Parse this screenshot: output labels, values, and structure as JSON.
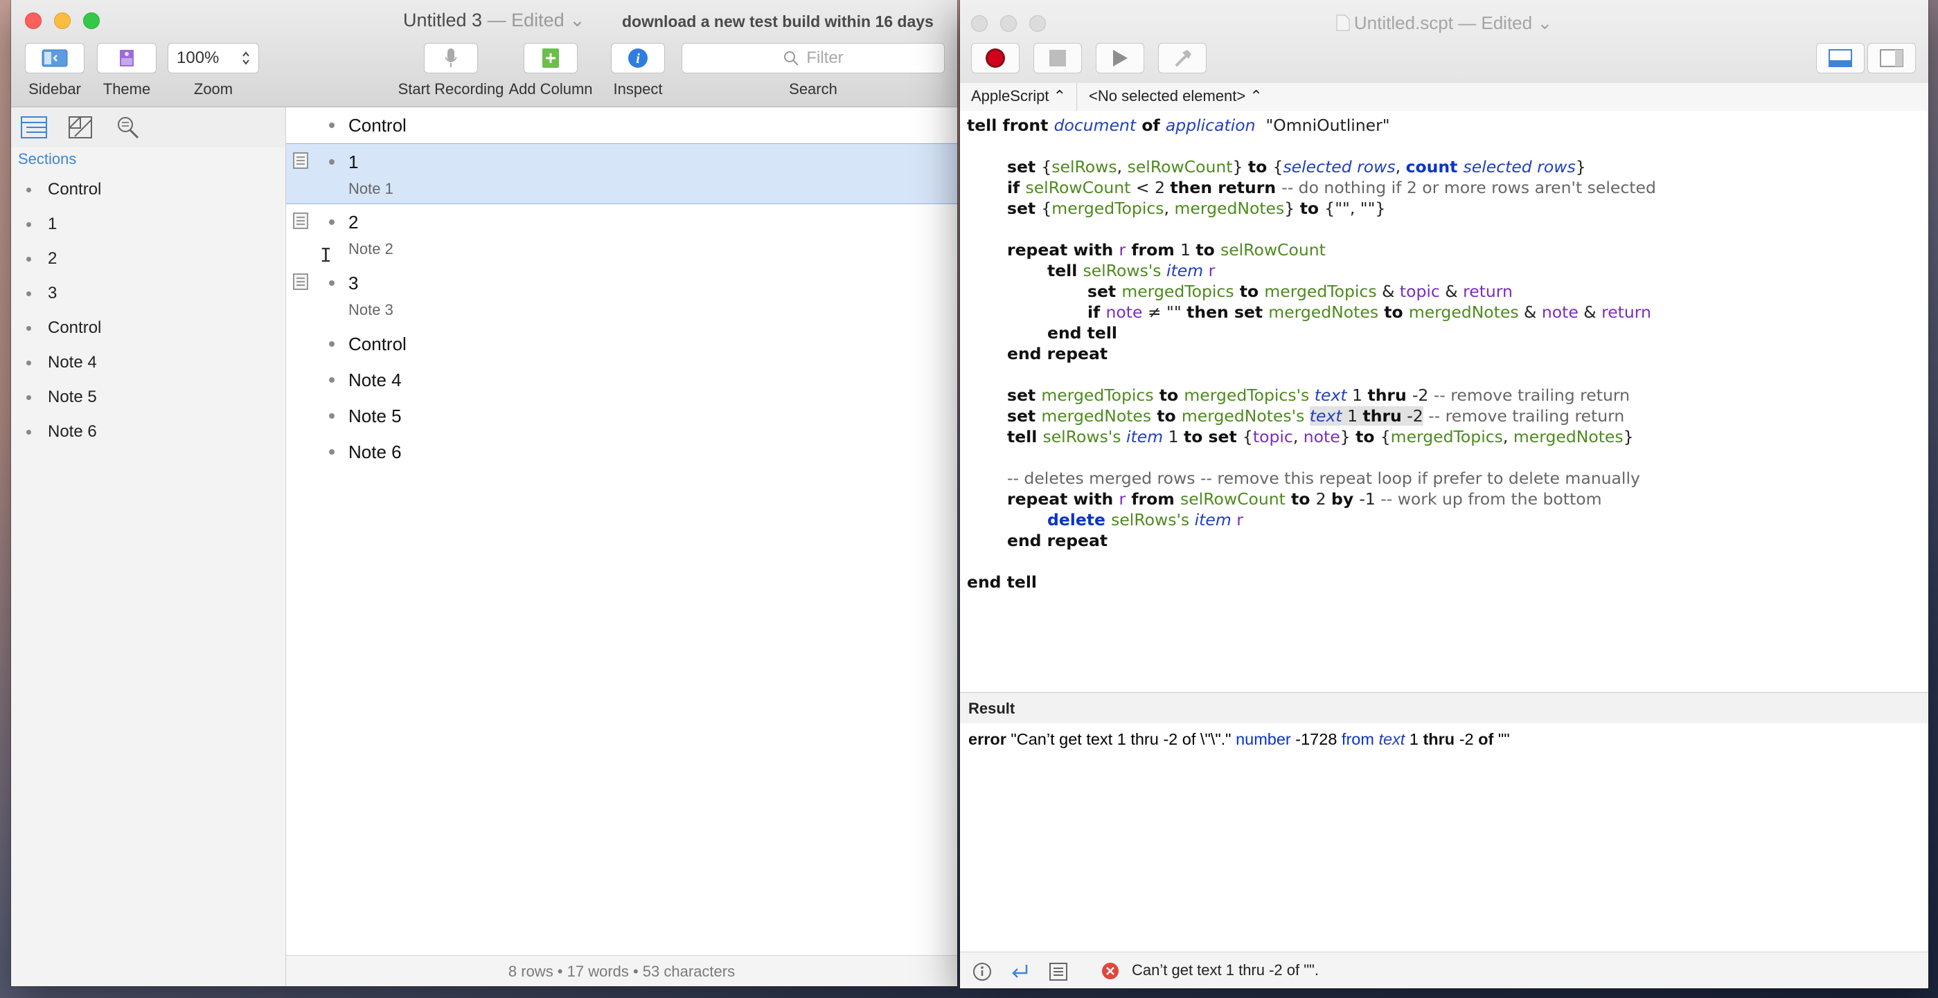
{
  "outliner": {
    "title": "Untitled 3",
    "edited": " — Edited ⌄",
    "notice": "download a new test build within 16 days",
    "toolbar": {
      "sidebar_label": "Sidebar",
      "theme_label": "Theme",
      "zoom_label": "Zoom",
      "zoom_value": "100%",
      "record_label": "Start Recording",
      "add_column_label": "Add Column",
      "inspect_label": "Inspect",
      "search_label": "Search",
      "filter_placeholder": "Filter"
    },
    "sidebar": {
      "section_header": "Sections",
      "items": [
        "Control",
        "1",
        "2",
        "3",
        "Control",
        "Note 4",
        "Note 5",
        "Note 6"
      ]
    },
    "rows": [
      {
        "topic": "Control",
        "note": ""
      },
      {
        "topic": "1",
        "note": "Note 1"
      },
      {
        "topic": "2",
        "note": "Note 2"
      },
      {
        "topic": "3",
        "note": "Note 3"
      },
      {
        "topic": "Control",
        "note": ""
      },
      {
        "topic": "Note 4",
        "note": ""
      },
      {
        "topic": "Note 5",
        "note": ""
      },
      {
        "topic": "Note 6",
        "note": ""
      }
    ],
    "status": "8 rows • 17 words • 53 characters"
  },
  "script_editor": {
    "title": "Untitled.scpt",
    "edited": " — Edited ⌄",
    "language": "AppleScript ⌃",
    "element": "<No selected element> ⌃",
    "result_header": "Result",
    "result": {
      "p1": "error",
      "p2": " \"Can’t get text 1 thru -2 of \\\"\\\".\" ",
      "p3": "number",
      "p4": " -1728 ",
      "p5": "from",
      "p6": " ",
      "p7": "text",
      "p8": " 1 ",
      "p9": "thru",
      "p10": " -2 ",
      "p11": "of",
      "p12": " \"\""
    },
    "status_message": "Can’t get text 1 thru -2 of \"\".",
    "code": [
      {
        "indent": 0,
        "segs": [
          [
            "k",
            "tell front "
          ],
          [
            "app",
            "document"
          ],
          [
            "k",
            " of "
          ],
          [
            "app",
            "application"
          ],
          [
            "",
            "  \"OmniOutliner\""
          ]
        ]
      },
      {
        "indent": 0,
        "segs": []
      },
      {
        "indent": 1,
        "segs": [
          [
            "k",
            "set "
          ],
          [
            "",
            "{"
          ],
          [
            "g",
            "selRows"
          ],
          [
            "",
            ", "
          ],
          [
            "g",
            "selRowCount"
          ],
          [
            "",
            "} "
          ],
          [
            "k",
            "to "
          ],
          [
            "",
            "{"
          ],
          [
            "app",
            "selected rows"
          ],
          [
            "",
            ", "
          ],
          [
            "kb",
            "count "
          ],
          [
            "app",
            "selected rows"
          ],
          [
            "",
            "}"
          ]
        ]
      },
      {
        "indent": 1,
        "segs": [
          [
            "k",
            "if "
          ],
          [
            "g",
            "selRowCount"
          ],
          [
            "",
            " < 2 "
          ],
          [
            "k",
            "then return "
          ],
          [
            "cm",
            "-- do nothing if 2 or more rows aren't selected"
          ]
        ]
      },
      {
        "indent": 1,
        "segs": [
          [
            "k",
            "set "
          ],
          [
            "",
            "{"
          ],
          [
            "g",
            "mergedTopics"
          ],
          [
            "",
            ", "
          ],
          [
            "g",
            "mergedNotes"
          ],
          [
            "",
            "} "
          ],
          [
            "k",
            "to "
          ],
          [
            "",
            "{\"\", \"\"}"
          ]
        ]
      },
      {
        "indent": 0,
        "segs": []
      },
      {
        "indent": 1,
        "segs": [
          [
            "k",
            "repeat with "
          ],
          [
            "p",
            "r"
          ],
          [
            "k",
            " from "
          ],
          [
            "",
            "1 "
          ],
          [
            "k",
            "to "
          ],
          [
            "g",
            "selRowCount"
          ]
        ]
      },
      {
        "indent": 2,
        "segs": [
          [
            "k",
            "tell "
          ],
          [
            "g",
            "selRows's "
          ],
          [
            "app",
            "item "
          ],
          [
            "p",
            "r"
          ]
        ]
      },
      {
        "indent": 3,
        "segs": [
          [
            "k",
            "set "
          ],
          [
            "g",
            "mergedTopics"
          ],
          [
            "k",
            " to "
          ],
          [
            "g",
            "mergedTopics"
          ],
          [
            "",
            " & "
          ],
          [
            "p",
            "topic"
          ],
          [
            "",
            " & "
          ],
          [
            "p",
            "return"
          ]
        ]
      },
      {
        "indent": 3,
        "segs": [
          [
            "k",
            "if "
          ],
          [
            "p",
            "note"
          ],
          [
            "",
            " ≠ \"\" "
          ],
          [
            "k",
            "then set "
          ],
          [
            "g",
            "mergedNotes"
          ],
          [
            "k",
            " to "
          ],
          [
            "g",
            "mergedNotes"
          ],
          [
            "",
            " & "
          ],
          [
            "p",
            "note"
          ],
          [
            "",
            " & "
          ],
          [
            "p",
            "return"
          ]
        ]
      },
      {
        "indent": 2,
        "segs": [
          [
            "k",
            "end tell"
          ]
        ]
      },
      {
        "indent": 1,
        "segs": [
          [
            "k",
            "end repeat"
          ]
        ]
      },
      {
        "indent": 0,
        "segs": []
      },
      {
        "indent": 1,
        "segs": [
          [
            "k",
            "set "
          ],
          [
            "g",
            "mergedTopics"
          ],
          [
            "k",
            " to "
          ],
          [
            "g",
            "mergedTopics's "
          ],
          [
            "app",
            "text"
          ],
          [
            "",
            " 1 "
          ],
          [
            "k",
            "thru "
          ],
          [
            "",
            "-2 "
          ],
          [
            "cm",
            "-- remove trailing return"
          ]
        ]
      },
      {
        "indent": 1,
        "segs": [
          [
            "k",
            "set "
          ],
          [
            "g",
            "mergedNotes"
          ],
          [
            "k",
            " to "
          ],
          [
            "g",
            "mergedNotes's "
          ],
          [
            "app hl",
            "text"
          ],
          [
            "hl",
            " 1 "
          ],
          [
            "k hl",
            "thru"
          ],
          [
            "hl",
            " -2"
          ],
          [
            "cm",
            " -- remove trailing return"
          ]
        ]
      },
      {
        "indent": 1,
        "segs": [
          [
            "k",
            "tell "
          ],
          [
            "g",
            "selRows's "
          ],
          [
            "app",
            "item "
          ],
          [
            "",
            "1 "
          ],
          [
            "k",
            "to set "
          ],
          [
            "",
            "{"
          ],
          [
            "p",
            "topic"
          ],
          [
            "",
            ", "
          ],
          [
            "p",
            "note"
          ],
          [
            "",
            "} "
          ],
          [
            "k",
            "to "
          ],
          [
            "",
            "{"
          ],
          [
            "g",
            "mergedTopics"
          ],
          [
            "",
            ", "
          ],
          [
            "g",
            "mergedNotes"
          ],
          [
            "",
            "}"
          ]
        ]
      },
      {
        "indent": 0,
        "segs": []
      },
      {
        "indent": 1,
        "segs": [
          [
            "cm",
            "-- deletes merged rows -- remove this repeat loop if prefer to delete manually"
          ]
        ]
      },
      {
        "indent": 1,
        "segs": [
          [
            "k",
            "repeat with "
          ],
          [
            "p",
            "r"
          ],
          [
            "k",
            " from "
          ],
          [
            "g",
            "selRowCount"
          ],
          [
            "k",
            " to "
          ],
          [
            "",
            "2 "
          ],
          [
            "k",
            "by "
          ],
          [
            "",
            "-1 "
          ],
          [
            "cm",
            "-- work up from the bottom"
          ]
        ]
      },
      {
        "indent": 2,
        "segs": [
          [
            "kb",
            "delete "
          ],
          [
            "g",
            "selRows's "
          ],
          [
            "app",
            "item "
          ],
          [
            "p",
            "r"
          ]
        ]
      },
      {
        "indent": 1,
        "segs": [
          [
            "k",
            "end repeat"
          ]
        ]
      },
      {
        "indent": 0,
        "segs": []
      },
      {
        "indent": 0,
        "segs": [
          [
            "k",
            "end tell"
          ]
        ]
      }
    ]
  },
  "colors": {
    "accent": "#3e86d5",
    "selection": "#d6e5f8",
    "record": "#d0021b",
    "error": "#e0473f"
  }
}
